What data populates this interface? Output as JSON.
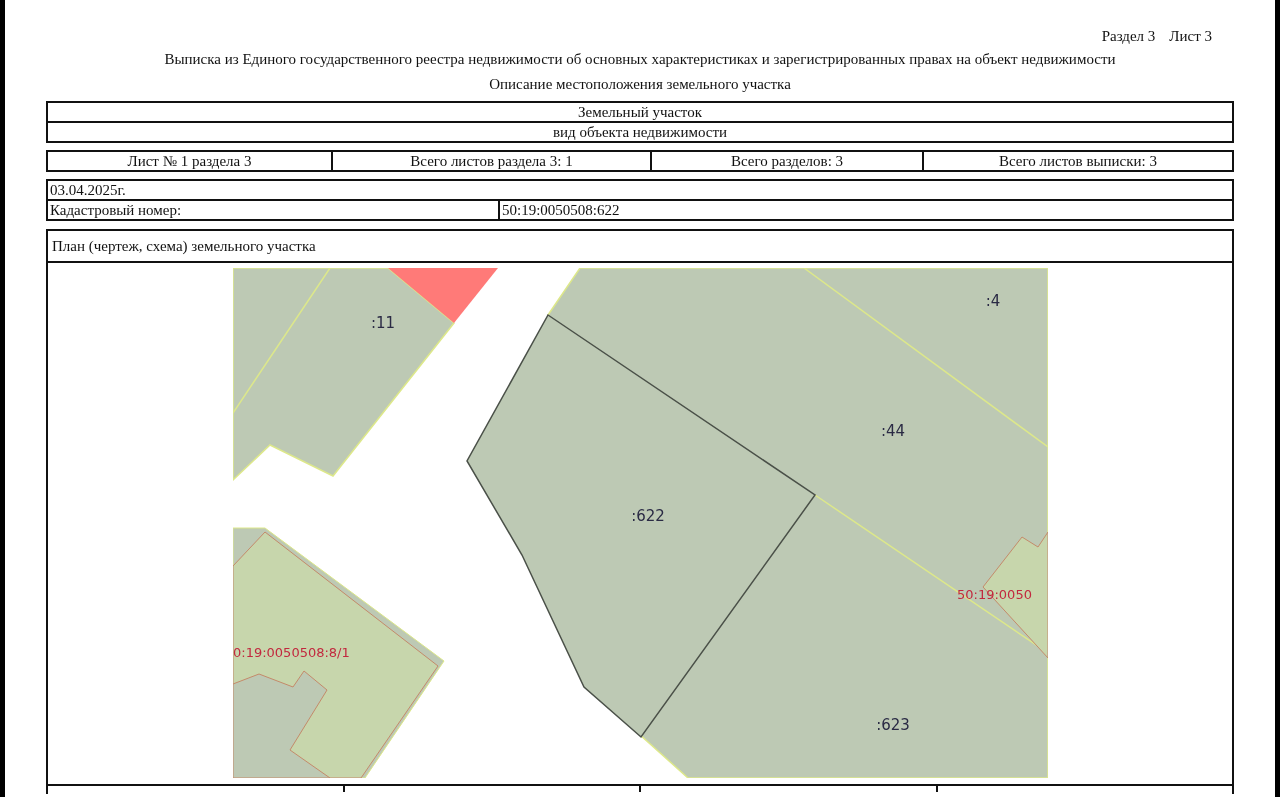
{
  "header": {
    "section_sheet": [
      "Раздел 3",
      "Лист 3"
    ],
    "title": "Выписка из Единого государственного реестра недвижимости об основных характеристиках и зарегистрированных правах на объект недвижимости",
    "subtitle": "Описание местоположения земельного участка"
  },
  "object_table": {
    "rows": [
      "Земельный участок",
      "вид объекта недвижимости"
    ]
  },
  "sheet_info": [
    "Лист № 1 раздела 3",
    "Всего листов раздела 3: 1",
    "Всего разделов: 3",
    "Всего листов выписки: 3"
  ],
  "date": "03.04.2025г.",
  "cadastral": {
    "label": "Кадастровый номер:",
    "value": "50:19:0050508:622"
  },
  "plan": {
    "title": "План (чертеж, схема) земельного участка",
    "map_labels": [
      {
        "text": ":11",
        "kind": "parcel"
      },
      {
        "text": ":4",
        "kind": "parcel"
      },
      {
        "text": ":44",
        "kind": "parcel"
      },
      {
        "text": ":622",
        "kind": "parcel"
      },
      {
        "text": ":623",
        "kind": "parcel"
      },
      {
        "text": "50:19:0050",
        "kind": "block"
      },
      {
        "text": "0:19:0050508:8/1",
        "kind": "block"
      }
    ]
  }
}
